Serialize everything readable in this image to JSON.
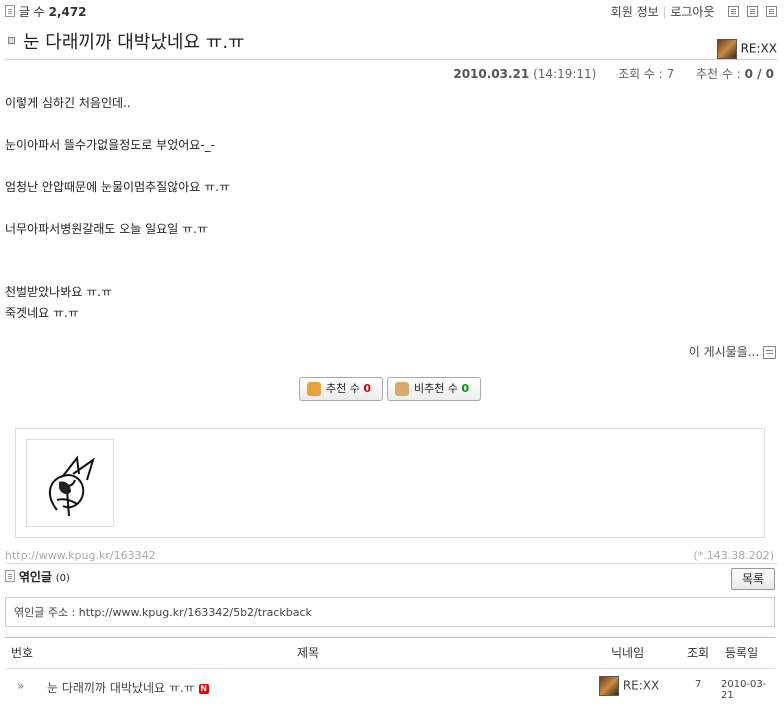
{
  "top": {
    "post_count_label": "글 수",
    "post_count": "2,472",
    "member_info": "회원 정보",
    "logout": "로그아웃"
  },
  "post": {
    "title": "눈 다래끼까 대박났네요 ㅠ.ㅠ",
    "author": "RE:XX",
    "date": "2010.03.21",
    "time": "(14:19:11)",
    "views_label": "조회 수 :",
    "views": "7",
    "votes_label": "추천 수 :",
    "votes": "0 / 0",
    "lines": [
      "이렇게 심하긴 처음인데..",
      "",
      "눈이아파서 뜰수가없을정도로 부었어요-_-",
      "",
      "엄청난 안압때문에 눈물이멈추질않아요 ㅠ.ㅠ",
      "",
      "너무아파서병원갈래도 오늘 일요일 ㅠ.ㅠ",
      "",
      "",
      "천벌받았나봐요 ㅠ.ㅠ",
      "죽겟네요 ㅠ.ㅠ"
    ],
    "this_post": "이 게시물을..."
  },
  "vote": {
    "up_label": "추천 수",
    "up_count": "0",
    "down_label": "비추천 수",
    "down_count": "0"
  },
  "footer": {
    "permalink": "http://www.kpug.kr/163342",
    "ip": "(*.143.38.202)"
  },
  "trackback": {
    "title": "엮인글",
    "count": "(0)",
    "list_button": "목록",
    "address": "엮인글 주소 : http://www.kpug.kr/163342/5b2/trackback"
  },
  "table": {
    "headers": [
      "번호",
      "제목",
      "닉네임",
      "조회",
      "등록일"
    ],
    "rows": [
      {
        "title": "눈 다래끼까 대박났네요 ㅠ.ㅠ",
        "badge": "N",
        "nickname": "RE:XX",
        "views": "7",
        "date": "2010-03-21"
      }
    ]
  }
}
